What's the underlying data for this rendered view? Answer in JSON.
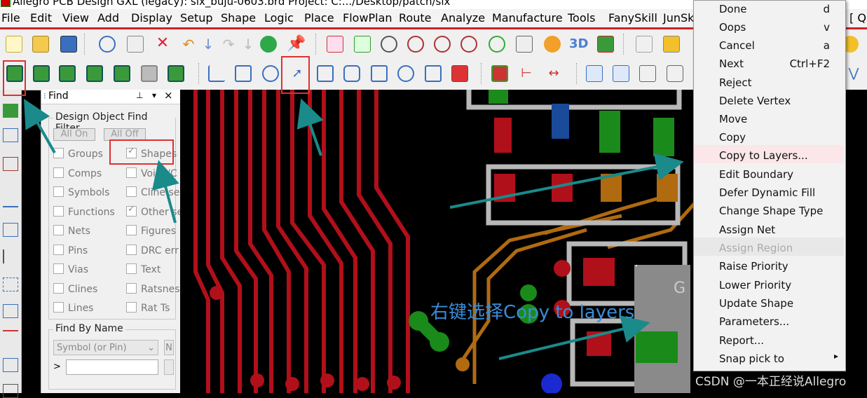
{
  "window": {
    "title": "Allegro PCB Design GXL (legacy): six_buju-0603.brd  Project: C:.../Desktop/patch/six"
  },
  "menubar": {
    "items": [
      "File",
      "Edit",
      "View",
      "Add",
      "Display",
      "Setup",
      "Shape",
      "Logic",
      "Place",
      "FlowPlan",
      "Route",
      "Analyze",
      "Manufacture",
      "Tools",
      "FanySkill",
      "JunSk"
    ],
    "right_label": "[ Q"
  },
  "find_panel": {
    "title": "Find",
    "pin_icon": "pin-icon",
    "menu_arrow": "▾",
    "close": "×",
    "filter_group_title": "Design Object Find Filter",
    "all_on": "All On",
    "all_off": "All Off",
    "left_items": [
      {
        "label": "Groups",
        "checked": false
      },
      {
        "label": "Comps",
        "checked": false
      },
      {
        "label": "Symbols",
        "checked": false
      },
      {
        "label": "Functions",
        "checked": false
      },
      {
        "label": "Nets",
        "checked": false
      },
      {
        "label": "Pins",
        "checked": false
      },
      {
        "label": "Vias",
        "checked": false
      },
      {
        "label": "Clines",
        "checked": false
      },
      {
        "label": "Lines",
        "checked": false
      }
    ],
    "right_items": [
      {
        "label": "Shapes",
        "checked": true
      },
      {
        "label": "Voids/C",
        "checked": false
      },
      {
        "label": "Cline se",
        "checked": false
      },
      {
        "label": "Other se",
        "checked": true
      },
      {
        "label": "Figures",
        "checked": false
      },
      {
        "label": "DRC err",
        "checked": false
      },
      {
        "label": "Text",
        "checked": false
      },
      {
        "label": "Ratsnes",
        "checked": false
      },
      {
        "label": "Rat Ts",
        "checked": false
      }
    ],
    "find_by_name_title": "Find By Name",
    "find_by_name_select": "Symbol (or Pin)",
    "find_by_name_side": "N",
    "find_by_name_prompt": ">",
    "find_by_name_value": ""
  },
  "context_menu": {
    "items": [
      {
        "label": "Done",
        "accel": "d",
        "disabled": false
      },
      {
        "label": "Oops",
        "accel": "v",
        "disabled": false
      },
      {
        "label": "Cancel",
        "accel": "a",
        "disabled": false
      },
      {
        "label": "Next",
        "accel": "Ctrl+F2",
        "disabled": false
      },
      {
        "label": "Reject",
        "accel": "",
        "disabled": false
      },
      {
        "label": "Delete Vertex",
        "accel": "",
        "disabled": false
      },
      {
        "label": "Move",
        "accel": "",
        "disabled": false
      },
      {
        "label": "Copy",
        "accel": "",
        "disabled": false
      },
      {
        "label": "Copy to Layers...",
        "accel": "",
        "disabled": false,
        "highlighted": true
      },
      {
        "label": "Edit Boundary",
        "accel": "",
        "disabled": false
      },
      {
        "label": "Defer Dynamic Fill",
        "accel": "",
        "disabled": false
      },
      {
        "label": "Change Shape Type",
        "accel": "",
        "disabled": false
      },
      {
        "label": "Assign Net",
        "accel": "",
        "disabled": false
      },
      {
        "label": "Assign Region",
        "accel": "",
        "disabled": true
      },
      {
        "label": "Raise Priority",
        "accel": "",
        "disabled": false
      },
      {
        "label": "Lower Priority",
        "accel": "",
        "disabled": false
      },
      {
        "label": "Update Shape",
        "accel": "",
        "disabled": false
      },
      {
        "label": "Parameters...",
        "accel": "",
        "disabled": false
      },
      {
        "label": "Report...",
        "accel": "",
        "disabled": false
      },
      {
        "label": "Snap pick to",
        "accel": "▸",
        "disabled": false
      }
    ]
  },
  "canvas": {
    "pad_label": "G"
  },
  "annotation": {
    "text": "右键选择Copy to layers"
  },
  "watermark": {
    "text": "CSDN @一本正经说Allegro"
  },
  "colors": {
    "accent_red": "#e03030",
    "annotation_blue": "#3a8cd8",
    "arrow_teal": "#1a8a8a"
  }
}
